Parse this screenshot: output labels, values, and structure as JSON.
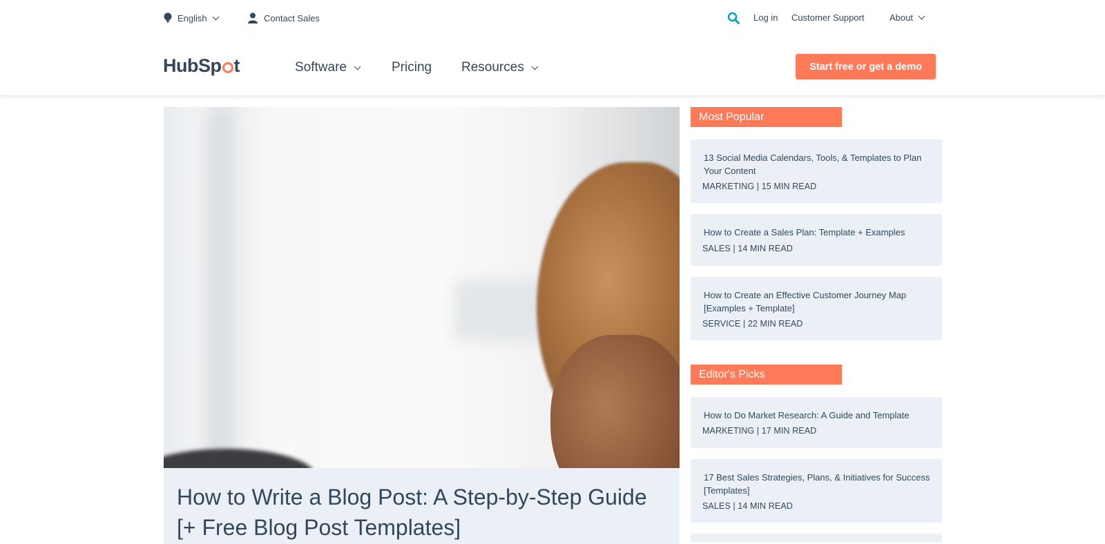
{
  "utility_bar": {
    "language": "English",
    "contact": "Contact Sales",
    "login": "Log in",
    "support": "Customer Support",
    "about": "About"
  },
  "nav": {
    "logo": {
      "part1": "HubSp",
      "part2": "t"
    },
    "links": [
      "Software",
      "Pricing",
      "Resources"
    ],
    "cta": "Start free or get a demo"
  },
  "hero": {
    "title": "How to Write a Blog Post: A Step-by-Step Guide [+ Free Blog Post Templates]"
  },
  "sidebar": {
    "most_popular": {
      "heading": "Most Popular",
      "items": [
        {
          "title": "13 Social Media Calendars, Tools, & Templates to Plan Your Content",
          "meta": "MARKETING | 15 MIN READ"
        },
        {
          "title": "How to Create a Sales Plan: Template + Examples",
          "meta": "SALES | 14 MIN READ"
        },
        {
          "title": "How to Create an Effective Customer Journey Map [Examples + Template]",
          "meta": "SERVICE | 22 MIN READ"
        }
      ]
    },
    "editors_picks": {
      "heading": "Editor's Picks",
      "items": [
        {
          "title": "How to Do Market Research: A Guide and Template",
          "meta": "MARKETING | 17 MIN READ"
        },
        {
          "title": "17 Best Sales Strategies, Plans, & Initiatives for Success [Templates]",
          "meta": "SALES | 14 MIN READ"
        }
      ]
    }
  },
  "colors": {
    "accent": "#ff7a59",
    "text": "#33475b",
    "card_bg": "#eaf0f6",
    "search_icon": "#00a4bd"
  }
}
